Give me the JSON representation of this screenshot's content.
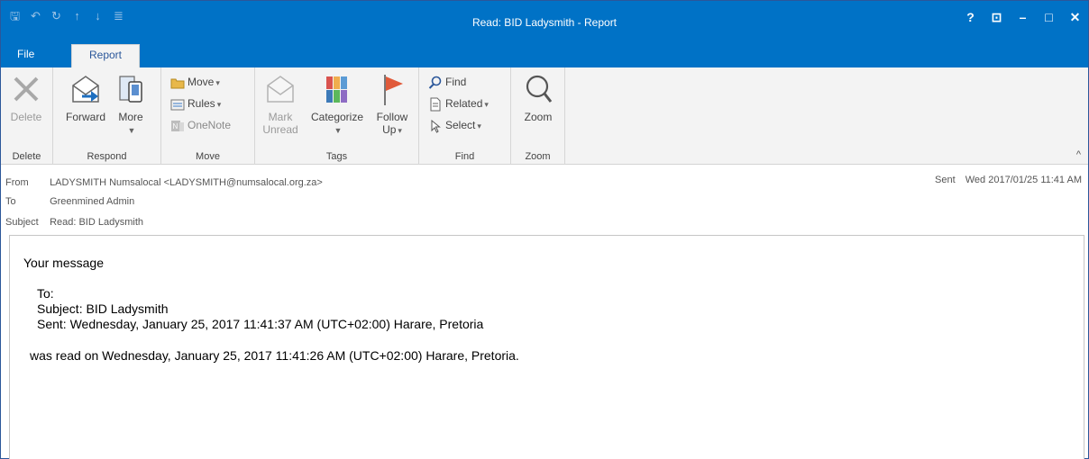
{
  "window": {
    "title": "Read: BID Ladysmith - Report",
    "accent": "#0072c6"
  },
  "qat": {
    "icons": [
      "save-icon",
      "undo-icon",
      "redo-icon",
      "up-icon",
      "down-icon",
      "customize-icon"
    ]
  },
  "controls": {
    "help": "?",
    "restore_ribbon": "⊡",
    "minimize": "–",
    "maximize": "□",
    "close": "✕"
  },
  "tabs": {
    "file": "File",
    "report": "Report"
  },
  "ribbon": {
    "delete_group": {
      "label": "Delete",
      "delete": "Delete"
    },
    "respond_group": {
      "label": "Respond",
      "forward": "Forward",
      "more": "More"
    },
    "move_group": {
      "label": "Move",
      "move": "Move",
      "rules": "Rules",
      "onenote": "OneNote"
    },
    "tags_group": {
      "label": "Tags",
      "mark": "Mark",
      "unread": "Unread",
      "categorize": "Categorize",
      "follow": "Follow",
      "up": "Up"
    },
    "find_group": {
      "label": "Find",
      "find": "Find",
      "related": "Related",
      "select": "Select"
    },
    "zoom_group": {
      "label": "Zoom",
      "zoom": "Zoom"
    }
  },
  "header": {
    "from_label": "From",
    "from_value": "LADYSMITH Numsalocal <LADYSMITH@numsalocal.org.za>",
    "to_label": "To",
    "to_value": "Greenmined Admin",
    "subject_label": "Subject",
    "subject_value": "Read: BID Ladysmith",
    "sent_label": "Sent",
    "sent_value": "Wed 2017/01/25 11:41 AM"
  },
  "message": {
    "line1": "Your message",
    "line2": "To:",
    "line3": "Subject: BID Ladysmith",
    "line4": "Sent: Wednesday, January 25, 2017 11:41:37 AM (UTC+02:00) Harare, Pretoria",
    "line5": "was read on Wednesday, January 25, 2017 11:41:26 AM (UTC+02:00) Harare, Pretoria."
  }
}
